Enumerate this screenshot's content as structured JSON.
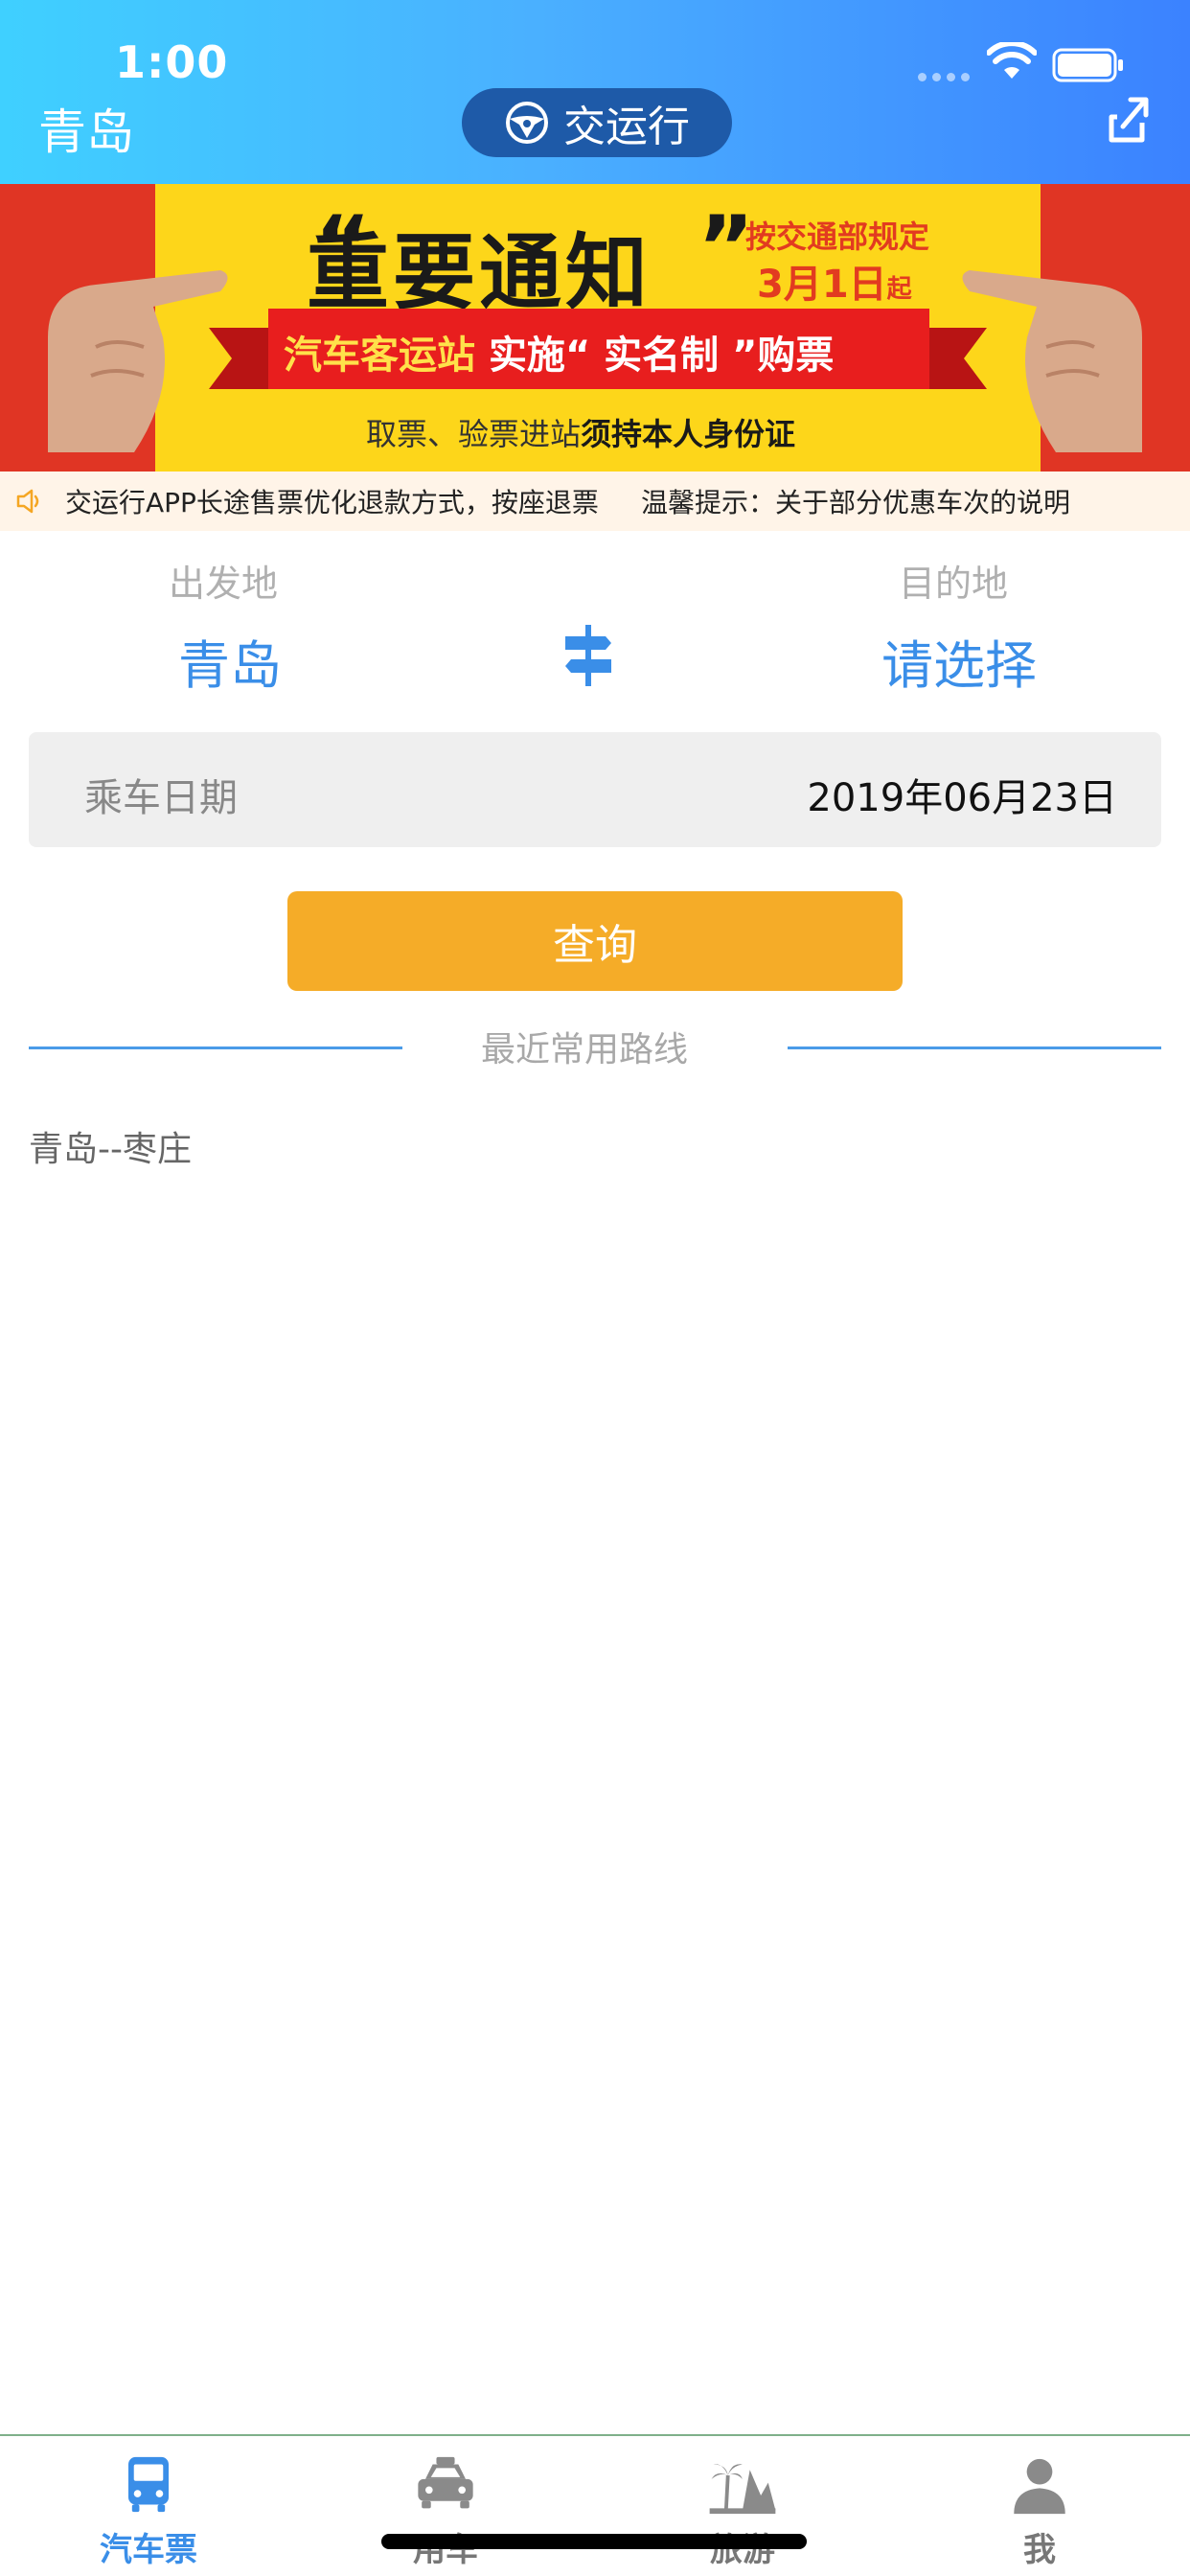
{
  "status": {
    "time": "1:00"
  },
  "header": {
    "city": "青岛",
    "brand": "交运行"
  },
  "banner": {
    "title": "重要通知",
    "rule": "按交通部规定",
    "date": "3月1日",
    "date_suffix": "起",
    "ribbon_station": "汽车客运站",
    "ribbon_action": "实施",
    "ribbon_policy": "“ 实名制 ”",
    "ribbon_end": "购票",
    "foot_plain": "取票、验票进站",
    "foot_bold": "须持本人身份证"
  },
  "notice": {
    "text1": "交运行APP长途售票优化退款方式，按座退票",
    "text2": "温馨提示：关于部分优惠车次的说明"
  },
  "route": {
    "from_label": "出发地",
    "from_value": "青岛",
    "to_label": "目的地",
    "to_value": "请选择"
  },
  "date": {
    "label": "乘车日期",
    "value": "2019年06月23日"
  },
  "query_button": "查询",
  "recent": {
    "title": "最近常用路线",
    "items": [
      "青岛--枣庄"
    ]
  },
  "tabs": [
    {
      "label": "汽车票",
      "icon": "bus-icon",
      "active": true
    },
    {
      "label": "用车",
      "icon": "car-icon",
      "active": false
    },
    {
      "label": "旅游",
      "icon": "palm-tree-icon",
      "active": false
    },
    {
      "label": "我",
      "icon": "person-icon",
      "active": false
    }
  ],
  "colors": {
    "primary_blue": "#3a8ee8",
    "button_orange": "#f5ac28",
    "header_gradient_start": "#3fd0ff",
    "header_gradient_end": "#3b82ff"
  }
}
